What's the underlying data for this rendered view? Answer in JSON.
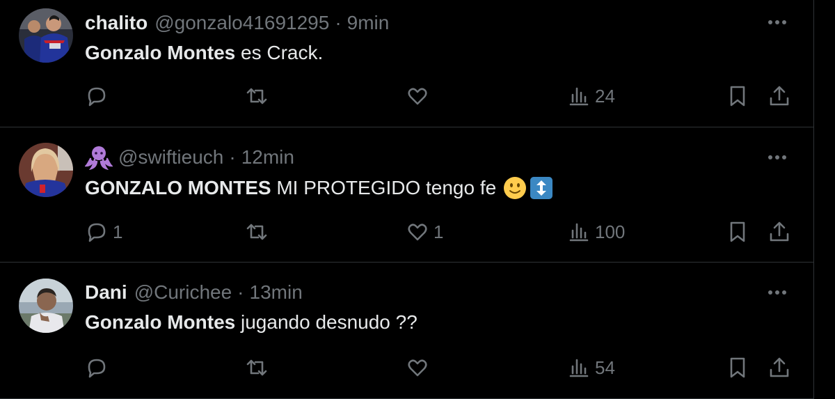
{
  "tweets": [
    {
      "display_name": "chalito",
      "handle": "@gonzalo41691295",
      "separator": "·",
      "time": "9min",
      "mention": "Gonzalo Montes",
      "text": " es Crack.",
      "reply_count": "",
      "retweet_count": "",
      "like_count": "",
      "views": "24",
      "avatar_icon": "avatar-photo-football-player"
    },
    {
      "display_name": "",
      "name_icon": "octopus-emoji",
      "handle": "@swiftieuch",
      "separator": "·",
      "time": "12min",
      "mention": "GONZALO MONTES",
      "text": " MI PROTEGIDO tengo fe",
      "emojis": [
        "slightly-smiling-face-emoji",
        "up-down-arrow-emoji"
      ],
      "reply_count": "1",
      "retweet_count": "",
      "like_count": "1",
      "views": "100",
      "avatar_icon": "avatar-photo-person-in-jersey"
    },
    {
      "display_name": "Dani",
      "handle": "@Curichee",
      "separator": "·",
      "time": "13min",
      "mention": "Gonzalo Montes",
      "text": " jugando desnudo ??",
      "reply_count": "",
      "retweet_count": "",
      "like_count": "",
      "views": "54",
      "avatar_icon": "avatar-photo-person-outdoors"
    }
  ],
  "colors": {
    "background": "#000000",
    "text_primary": "#e7e9ea",
    "text_secondary": "#71767b",
    "divider": "#2f3336"
  }
}
